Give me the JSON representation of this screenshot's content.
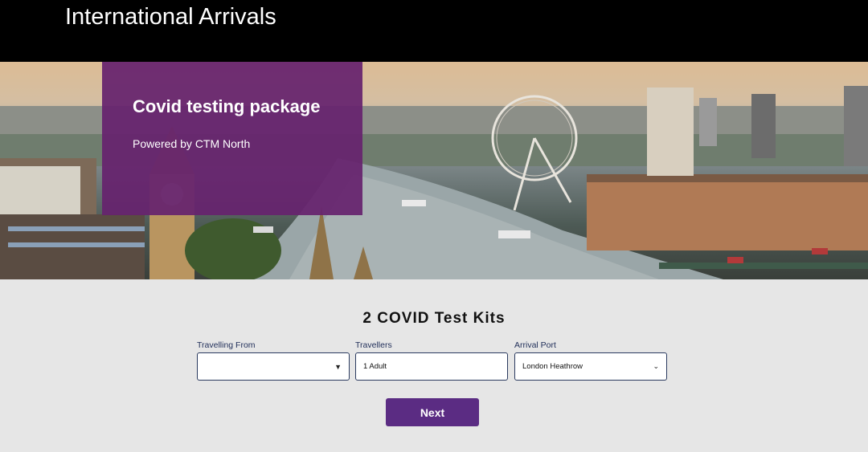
{
  "header": {
    "title": "International Arrivals"
  },
  "hero": {
    "heading": "Covid testing package",
    "subheading": "Powered by CTM North",
    "image": "london-skyline-image"
  },
  "form": {
    "title": "2 COVID Test Kits",
    "travelling_from": {
      "label": "Travelling From",
      "value": ""
    },
    "travellers": {
      "label": "Travellers",
      "value": "1 Adult"
    },
    "arrival_port": {
      "label": "Arrival Port",
      "value": "London Heathrow"
    },
    "next_label": "Next"
  },
  "colors": {
    "header_bg": "#000000",
    "panel_bg": "#66226e",
    "button_bg": "#5b2c83",
    "page_bg": "#e6e6e6"
  }
}
